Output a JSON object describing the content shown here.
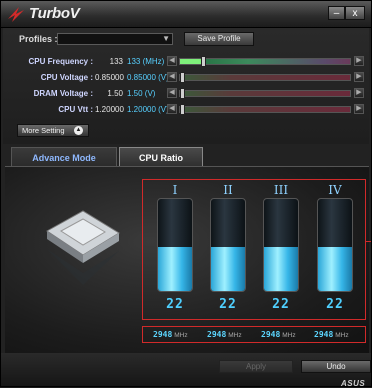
{
  "window": {
    "title": "TurboV",
    "minimize_glyph": "–",
    "close_glyph": "x"
  },
  "profiles": {
    "label": "Profiles :",
    "selected": "",
    "save_label": "Save Profile"
  },
  "controls": [
    {
      "label": "CPU Frequency :",
      "value": "133",
      "target": "133 (MHz)",
      "level": 0.13
    },
    {
      "label": "CPU Voltage :",
      "value": "0.85000",
      "target": "0.85000 (V)",
      "level": 0.0
    },
    {
      "label": "DRAM Voltage :",
      "value": "1.50",
      "target": "1.50 (V)",
      "level": 0.0
    },
    {
      "label": "CPU Vtt :",
      "value": "1.20000",
      "target": "1.20000 (V)",
      "level": 0.0
    }
  ],
  "more_setting": {
    "label": "More Setting",
    "icon": "chevron-up-icon"
  },
  "tabs": [
    {
      "label": "Advance Mode",
      "active": false
    },
    {
      "label": "CPU Ratio",
      "active": true
    }
  ],
  "cores": [
    {
      "numeral": "I",
      "ratio": "22",
      "level": 0.48,
      "mhz": "2948",
      "unit": "MHz"
    },
    {
      "numeral": "II",
      "ratio": "22",
      "level": 0.48,
      "mhz": "2948",
      "unit": "MHz"
    },
    {
      "numeral": "III",
      "ratio": "22",
      "level": 0.48,
      "mhz": "2948",
      "unit": "MHz"
    },
    {
      "numeral": "IV",
      "ratio": "22",
      "level": 0.48,
      "mhz": "2948",
      "unit": "MHz"
    }
  ],
  "footer": {
    "apply_label": "Apply",
    "undo_label": "Undo",
    "brand": "ASUS"
  },
  "colors": {
    "accent_blue": "#4fd0ff",
    "highlight_red": "#d12a2a",
    "slider_green": "#7ef07a"
  }
}
